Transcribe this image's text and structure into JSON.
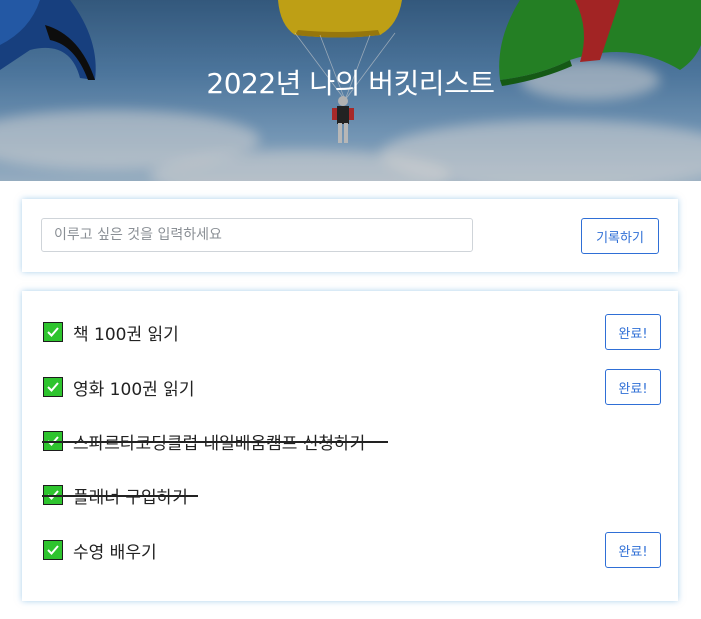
{
  "banner": {
    "title": "2022년 나의 버킷리스트"
  },
  "form": {
    "placeholder": "이루고 싶은 것을 입력하세요",
    "value": "",
    "submit_label": "기록하기"
  },
  "items": [
    {
      "text": "책 100권 읽기",
      "done": false,
      "action_label": "완료!"
    },
    {
      "text": "영화 100권 읽기",
      "done": false,
      "action_label": "완료!"
    },
    {
      "text": "스파르타코딩클럽 내일배움캠프 신청하기",
      "done": true
    },
    {
      "text": "플래너 구입하기",
      "done": true
    },
    {
      "text": "수영 배우기",
      "done": false,
      "action_label": "완료!"
    }
  ],
  "colors": {
    "accent": "#2f6fd6",
    "check": "#2ec42e"
  },
  "icons": {
    "check": "check-box-icon"
  }
}
